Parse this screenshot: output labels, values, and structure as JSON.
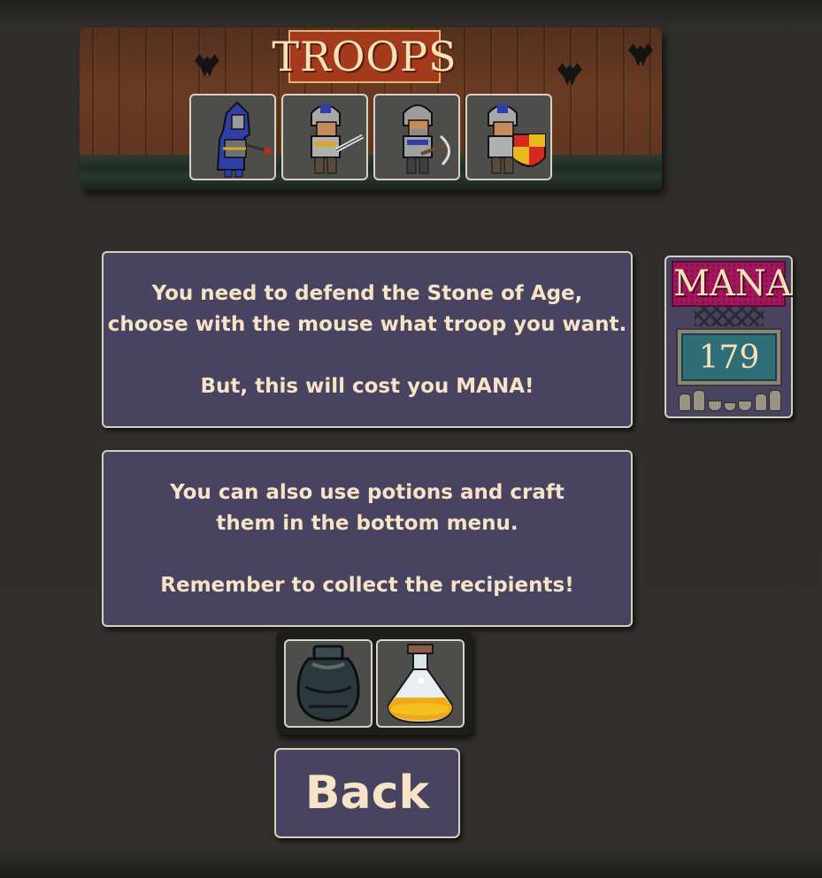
{
  "troops_banner": {
    "title": "TROOPS",
    "troops": [
      {
        "name": "hooded-mage",
        "icon": "mage-troop-icon"
      },
      {
        "name": "swordsman",
        "icon": "swordsman-troop-icon"
      },
      {
        "name": "crossbowman",
        "icon": "crossbowman-troop-icon"
      },
      {
        "name": "shield-knight",
        "icon": "shield-knight-troop-icon"
      }
    ]
  },
  "info_panel_troops": {
    "line1": "You need to defend the Stone of Age,",
    "line2": "choose with the mouse what troop you want.",
    "line3": "But, this will cost you MANA!"
  },
  "info_panel_potions": {
    "line1": "You can also use potions and craft",
    "line2": "them in the bottom menu.",
    "line3": "Remember to collect the recipients!"
  },
  "mana": {
    "label": "MANA",
    "value": "179"
  },
  "potions": [
    {
      "name": "empty-flask",
      "icon": "dark-flask-icon"
    },
    {
      "name": "golden-potion",
      "icon": "yellow-potion-icon"
    }
  ],
  "back_button": {
    "label": "Back"
  },
  "colors": {
    "panel": "#474360",
    "panel_border": "#d8d0bf",
    "text": "#f7e4c6",
    "troops_plate": "#a23a1b",
    "mana_plate": "#a3155c",
    "mana_value_bg": "#2f6e76"
  }
}
